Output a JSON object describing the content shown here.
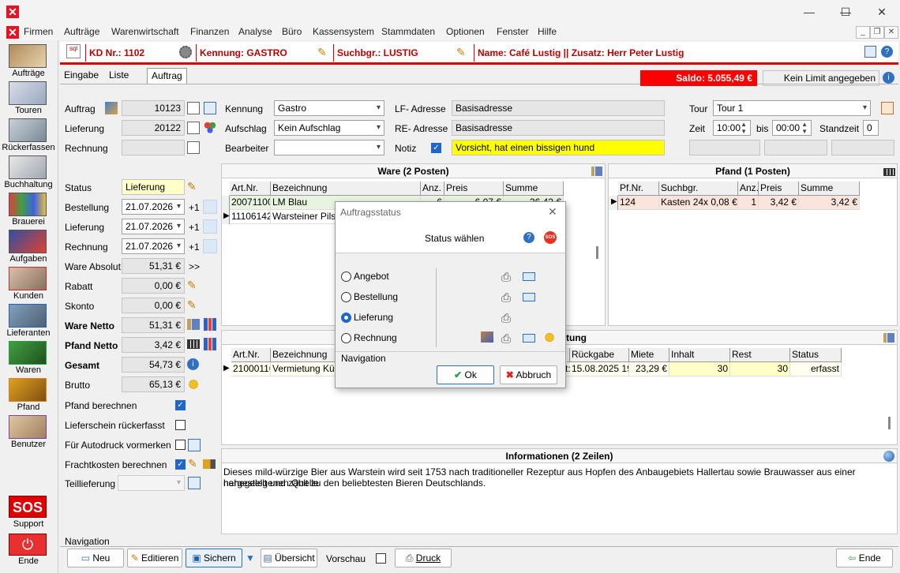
{
  "window": {
    "minimize": "—",
    "maximize": "☐",
    "close": "✕"
  },
  "menu": [
    "Firmen",
    "Aufträge",
    "Warenwirtschaft",
    "Finanzen",
    "Analyse",
    "Büro",
    "Kassensystem",
    "Stammdaten",
    "Optionen",
    "Fenster",
    "Hilfe"
  ],
  "sidebar": [
    {
      "label": "Aufträge"
    },
    {
      "label": "Touren"
    },
    {
      "label": "Rückerfassen"
    },
    {
      "label": "Buchhaltung"
    },
    {
      "label": "Brauerei"
    },
    {
      "label": "Aufgaben"
    },
    {
      "label": "Kunden"
    },
    {
      "label": "Lieferanten"
    },
    {
      "label": "Waren"
    },
    {
      "label": "Pfand"
    },
    {
      "label": "Benutzer"
    }
  ],
  "sidebar_bottom": {
    "sos": "SOS",
    "support": "Support",
    "ende": "Ende"
  },
  "header": {
    "kd": "KD Nr.: 1102",
    "kennung": "Kennung: GASTRO",
    "suchbgr": "Suchbgr.: LUSTIG",
    "name": "Name: Café Lustig || Zusatz: Herr Peter Lustig"
  },
  "tabs": [
    "Eingabe",
    "Liste",
    "Auftrag"
  ],
  "saldo": "Saldo: 5.055,49 €",
  "limit": "Kein Limit angegeben",
  "left": {
    "auftrag_label": "Auftrag",
    "auftrag": "10123",
    "lieferung_label": "Lieferung",
    "lieferung": "20122",
    "rechnung_label": "Rechnung",
    "rechnung": "",
    "status_label": "Status",
    "status": "Lieferung",
    "bestellung_label": "Bestellung",
    "bestellung_date": "21.07.2026",
    "lieferung2_label": "Lieferung",
    "lieferung_date": "21.07.2026",
    "rechnung2_label": "Rechnung",
    "rechnung_date": "21.07.2026",
    "plus": "+1",
    "ware_absolut_label": "Ware Absolut",
    "ware_absolut": "51,31 €",
    "ware_arrow": ">>",
    "rabatt_label": "Rabatt",
    "rabatt": "0,00 €",
    "skonto_label": "Skonto",
    "skonto": "0,00 €",
    "ware_netto_label": "Ware Netto",
    "ware_netto": "51,31 €",
    "pfand_netto_label": "Pfand Netto",
    "pfand_netto": "3,42 €",
    "gesamt_label": "Gesamt",
    "gesamt": "54,73 €",
    "brutto_label": "Brutto",
    "brutto": "65,13 €",
    "pfand_berechnen": "Pfand berechnen",
    "lieferschein": "Lieferschein rückerfasst",
    "autodruck": "Für Autodruck vormerken",
    "fracht": "Frachtkosten berechnen",
    "teillieferung": "Teillieferung"
  },
  "mid": {
    "kennung_label": "Kennung",
    "kennung": "Gastro",
    "aufschlag_label": "Aufschlag",
    "aufschlag": "Kein Aufschlag",
    "bearbeiter_label": "Bearbeiter",
    "bearbeiter": "",
    "lf_label": "LF- Adresse",
    "lf": "Basisadresse",
    "re_label": "RE- Adresse",
    "re": "Basisadresse",
    "notiz_label": "Notiz",
    "notiz": "Vorsicht, hat einen bissigen hund"
  },
  "tour": {
    "label": "Tour",
    "value": "Tour 1",
    "zeit_label": "Zeit",
    "zeit_from": "10:00",
    "bis": "bis",
    "zeit_to": "00:00",
    "standzeit_label": "Standzeit",
    "standzeit": "0"
  },
  "ware": {
    "title": "Ware (2 Posten)",
    "headers": [
      "Art.Nr.",
      "Bezeichnung",
      "Anz.",
      "Preis",
      "Summe"
    ],
    "rows": [
      [
        "20071100",
        "LM Blau",
        "6",
        "6,07 €",
        "36,42 €"
      ],
      [
        "11106142",
        "Warsteiner Pils K",
        "",
        "",
        ""
      ]
    ]
  },
  "pfand": {
    "title": "Pfand (1 Posten)",
    "headers": [
      "Pf.Nr.",
      "Suchbgr.",
      "Anz.",
      "Preis",
      "Summe"
    ],
    "rows": [
      [
        "124",
        "Kasten 24x 0,08 €",
        "1",
        "3,42 €",
        "3,42 €"
      ]
    ]
  },
  "miete": {
    "title_suffix": "tung",
    "headers": [
      "Art.Nr.",
      "Bezeichnung",
      "",
      "Rückgabe",
      "Miete",
      "Inhalt",
      "Rest",
      "Status"
    ],
    "rows": [
      [
        "21000110",
        "Vermietung Kühl",
        "t:",
        "15.08.2025 19:",
        "23,29 €",
        "30",
        "30",
        "erfasst"
      ]
    ]
  },
  "info": {
    "title": "Informationen (2 Zeilen)",
    "text1": "Dieses mild-würzige Bier aus Warstein wird seit 1753 nach traditioneller Rezeptur aus Hopfen des Anbaugebiets Hallertau sowie Brauwasser aus einer nahegelegenen Quelle",
    "text2": "hergestellt und zählt zu den beliebtesten Bieren Deutschlands."
  },
  "bottom": {
    "nav": "Navigation",
    "neu": "Neu",
    "editieren": "Editieren",
    "sichern": "Sichern",
    "uebersicht": "Übersicht",
    "vorschau": "Vorschau",
    "druck": "Druck",
    "ende": "Ende"
  },
  "dialog": {
    "title": "Auftragsstatus",
    "subtitle": "Status wählen",
    "help": "?",
    "sos": "SOS",
    "options": [
      "Angebot",
      "Bestellung",
      "Lieferung",
      "Rechnung"
    ],
    "selected": "Lieferung",
    "nav": "Navigation",
    "ok": "Ok",
    "abbruch": "Abbruch"
  },
  "colors": {
    "accent": "#e00000",
    "saldo_bg": "#ff0000",
    "selection": "#1e66c8",
    "notiz_bg": "#ffff00"
  }
}
